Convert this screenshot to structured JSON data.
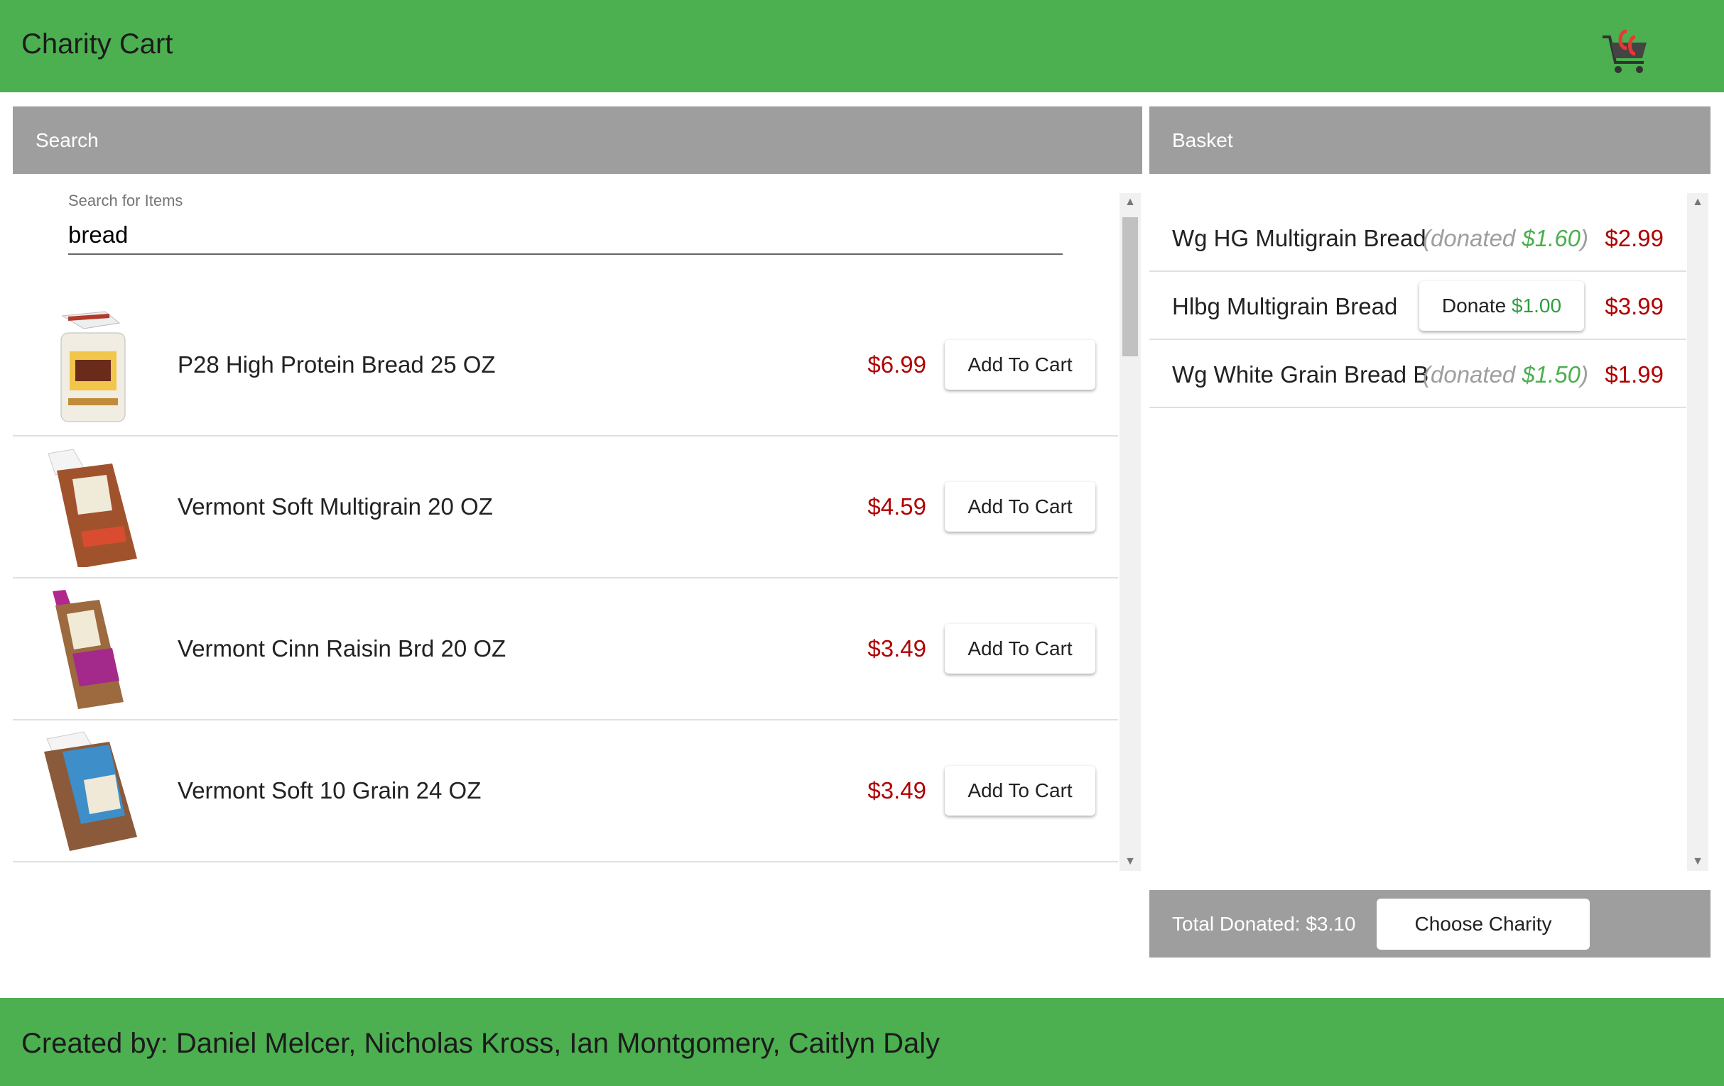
{
  "header": {
    "title": "Charity Cart",
    "logo_icon": "cart-logo-icon"
  },
  "search": {
    "panel_title": "Search",
    "label": "Search for Items",
    "value": "bread"
  },
  "results": [
    {
      "name": "P28 High Protein Bread 25 OZ",
      "price": "$6.99",
      "action": "Add To Cart"
    },
    {
      "name": "Vermont Soft Multigrain 20 OZ",
      "price": "$4.59",
      "action": "Add To Cart"
    },
    {
      "name": "Vermont Cinn Raisin Brd 20 OZ",
      "price": "$3.49",
      "action": "Add To Cart"
    },
    {
      "name": "Vermont Soft 10 Grain 24 OZ",
      "price": "$3.49",
      "action": "Add To Cart"
    }
  ],
  "basket": {
    "panel_title": "Basket",
    "items": [
      {
        "name": "Wg HG Multigrain Bread",
        "donated_prefix": "(donated ",
        "donated_amount": "$1.60",
        "donated_suffix": ")",
        "price": "$2.99"
      },
      {
        "name": "Hlbg Multigrain Bread",
        "donate_label": "Donate",
        "donate_amount": "$1.00",
        "price": "$3.99"
      },
      {
        "name": "Wg White Grain Bread B",
        "donated_prefix": "(donated ",
        "donated_amount": "$1.50",
        "donated_suffix": ")",
        "price": "$1.99"
      }
    ],
    "total_donated": "Total Donated: $3.10",
    "choose_charity": "Choose Charity"
  },
  "footer": {
    "credits": "Created by: Daniel Melcer, Nicholas Kross, Ian Montgomery, Caitlyn Daly"
  },
  "colors": {
    "brand_green": "#4caf50",
    "panel_grey": "#9e9e9e",
    "price_red": "#b00000",
    "donation_green": "#4caf50"
  }
}
